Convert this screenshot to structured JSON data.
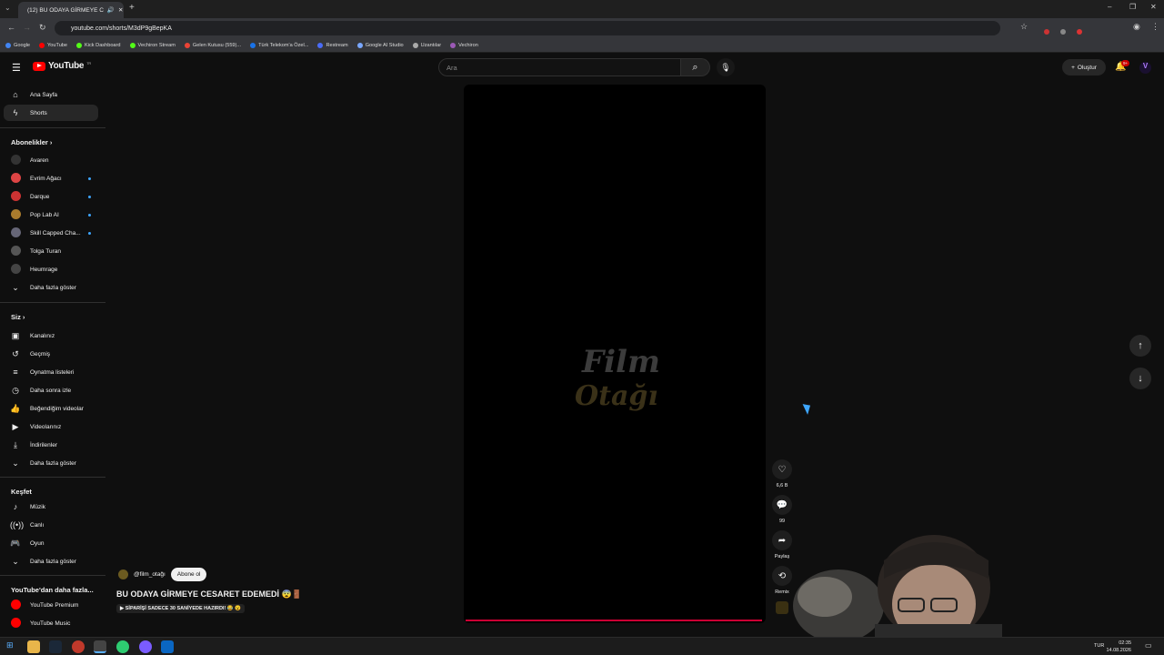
{
  "browser": {
    "tab_title": "(12) BU ODAYA GİRMEYE C",
    "url": "youtube.com/shorts/M3dP9gBepKA",
    "bookmarks": [
      "Google",
      "YouTube",
      "Kick Dashboard",
      "Vechiron Stream",
      "Gelen Kutusu (559)...",
      "Türk Telekom'a Özel...",
      "Restream",
      "Google AI Studio",
      "Uzantılar",
      "Vechiron"
    ]
  },
  "header": {
    "logo": "YouTube",
    "logo_country": "TR",
    "search_placeholder": "Ara",
    "create_label": "Oluştur",
    "notif_count": "9+"
  },
  "sidebar": {
    "main": [
      "Ana Sayfa",
      "Shorts"
    ],
    "subs_title": "Abonelikler",
    "subs": [
      "Avaren",
      "Evrim Ağacı",
      "Darque",
      "Pop Lab AI",
      "Skill Capped Cha...",
      "Tolga Turan",
      "Heumrage"
    ],
    "subs_more": "Daha fazla göster",
    "you_title": "Siz",
    "you": [
      "Kanalınız",
      "Geçmiş",
      "Oynatma listeleri",
      "Daha sonra izle",
      "Beğendiğim videolar",
      "Videolarınız",
      "İndirilenler"
    ],
    "you_more": "Daha fazla göster",
    "explore_title": "Keşfet",
    "explore": [
      "Müzik",
      "Canlı",
      "Oyun"
    ],
    "explore_more": "Daha fazla göster",
    "more_title": "YouTube'dan daha fazla...",
    "more": [
      "YouTube Premium",
      "YouTube Music"
    ]
  },
  "short": {
    "watermark_1": "Film",
    "watermark_2": "Otağı",
    "channel": "@film_otağı",
    "subscribe": "Abone ol",
    "title": "BU ODAYA GİRMEYE CESARET EDEMEDİ 😨🚪",
    "subtitle": "▶ SİPARİŞİ SADECE 30 SANİYEDE HAZIRDI! 😂 😮",
    "likes": "6,6 B",
    "comments": "99",
    "share": "Paylaş",
    "remix": "Remix"
  },
  "taskbar": {
    "lang": "TUR",
    "time": "02:35",
    "date": "14.08.2026"
  }
}
